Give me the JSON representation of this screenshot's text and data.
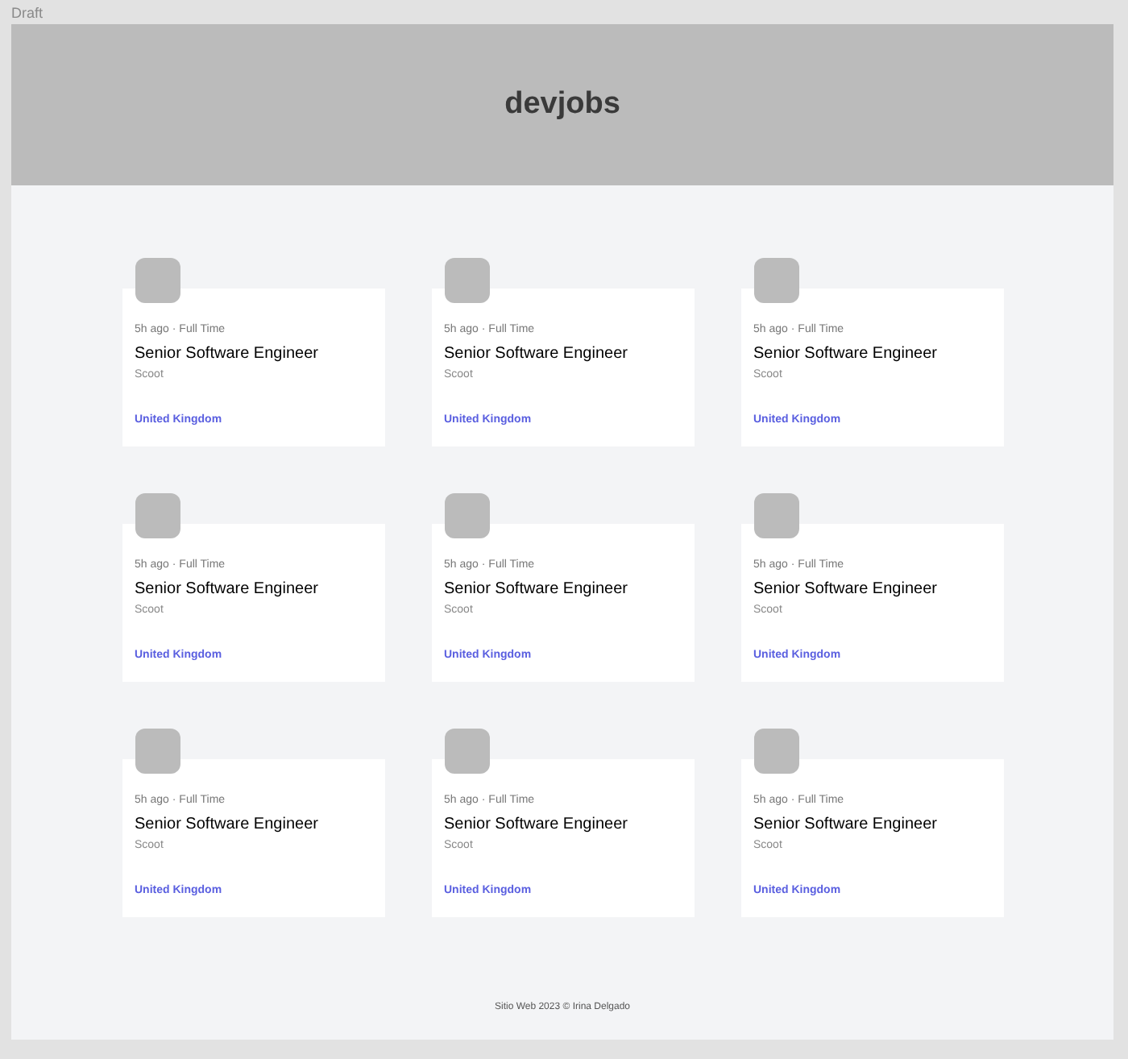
{
  "draft_label": "Draft",
  "header": {
    "title": "devjobs"
  },
  "jobs": [
    {
      "posted": "5h ago",
      "separator": "·",
      "contract": "Full Time",
      "position": "Senior Software Engineer",
      "company": "Scoot",
      "location": "United Kingdom"
    },
    {
      "posted": "5h ago",
      "separator": "·",
      "contract": "Full Time",
      "position": "Senior Software Engineer",
      "company": "Scoot",
      "location": "United Kingdom"
    },
    {
      "posted": "5h ago",
      "separator": "·",
      "contract": "Full Time",
      "position": "Senior Software Engineer",
      "company": "Scoot",
      "location": "United Kingdom"
    },
    {
      "posted": "5h ago",
      "separator": "·",
      "contract": "Full Time",
      "position": "Senior Software Engineer",
      "company": "Scoot",
      "location": "United Kingdom"
    },
    {
      "posted": "5h ago",
      "separator": "·",
      "contract": "Full Time",
      "position": "Senior Software Engineer",
      "company": "Scoot",
      "location": "United Kingdom"
    },
    {
      "posted": "5h ago",
      "separator": "·",
      "contract": "Full Time",
      "position": "Senior Software Engineer",
      "company": "Scoot",
      "location": "United Kingdom"
    },
    {
      "posted": "5h ago",
      "separator": "·",
      "contract": "Full Time",
      "position": "Senior Software Engineer",
      "company": "Scoot",
      "location": "United Kingdom"
    },
    {
      "posted": "5h ago",
      "separator": "·",
      "contract": "Full Time",
      "position": "Senior Software Engineer",
      "company": "Scoot",
      "location": "United Kingdom"
    },
    {
      "posted": "5h ago",
      "separator": "·",
      "contract": "Full Time",
      "position": "Senior Software Engineer",
      "company": "Scoot",
      "location": "United Kingdom"
    }
  ],
  "footer": "Sitio Web 2023 © Irina Delgado"
}
